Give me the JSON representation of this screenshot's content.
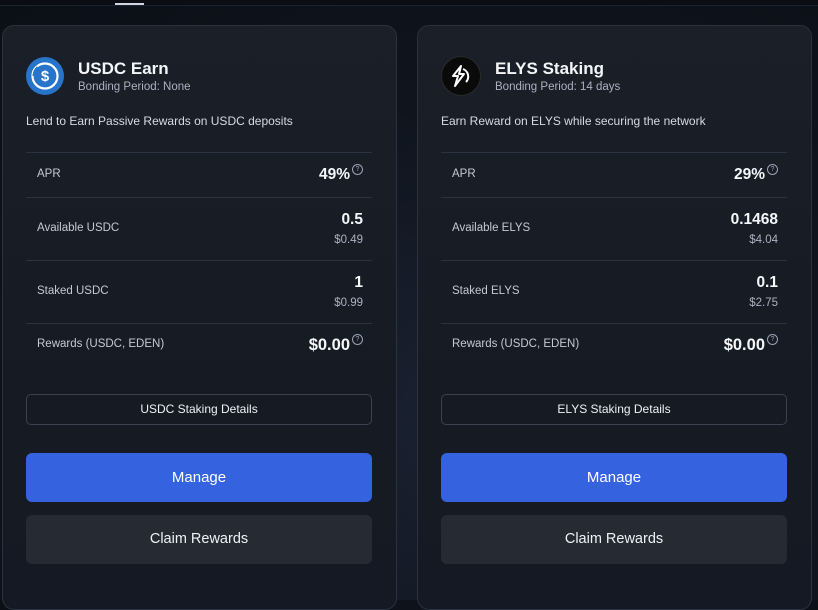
{
  "cards": [
    {
      "title": "USDC Earn",
      "bonding": "Bonding Period: None",
      "description": "Lend to Earn Passive Rewards on USDC deposits",
      "rows": [
        {
          "label": "APR",
          "value": "49%"
        },
        {
          "label": "Available USDC",
          "value": "0.5",
          "sub": "$0.49"
        },
        {
          "label": "Staked USDC",
          "value": "1",
          "sub": "$0.99"
        },
        {
          "label": "Rewards (USDC, EDEN)",
          "value": "$0.00"
        }
      ],
      "details_label": "USDC Staking Details",
      "manage_label": "Manage",
      "claim_label": "Claim Rewards",
      "icon": "usdc-logo"
    },
    {
      "title": "ELYS Staking",
      "bonding": "Bonding Period: 14 days",
      "description": "Earn Reward on ELYS while securing the network",
      "rows": [
        {
          "label": "APR",
          "value": "29%"
        },
        {
          "label": "Available ELYS",
          "value": "0.1468",
          "sub": "$4.04"
        },
        {
          "label": "Staked ELYS",
          "value": "0.1",
          "sub": "$2.75"
        },
        {
          "label": "Rewards (USDC, EDEN)",
          "value": "$0.00"
        }
      ],
      "details_label": "ELYS Staking Details",
      "manage_label": "Manage",
      "claim_label": "Claim Rewards",
      "icon": "elys-logo"
    }
  ],
  "help_glyph": "?",
  "colors": {
    "accent": "#3563e0",
    "usdc": "#2775ca",
    "card_bg": "#181d26",
    "secondary_button": "#262b33"
  }
}
